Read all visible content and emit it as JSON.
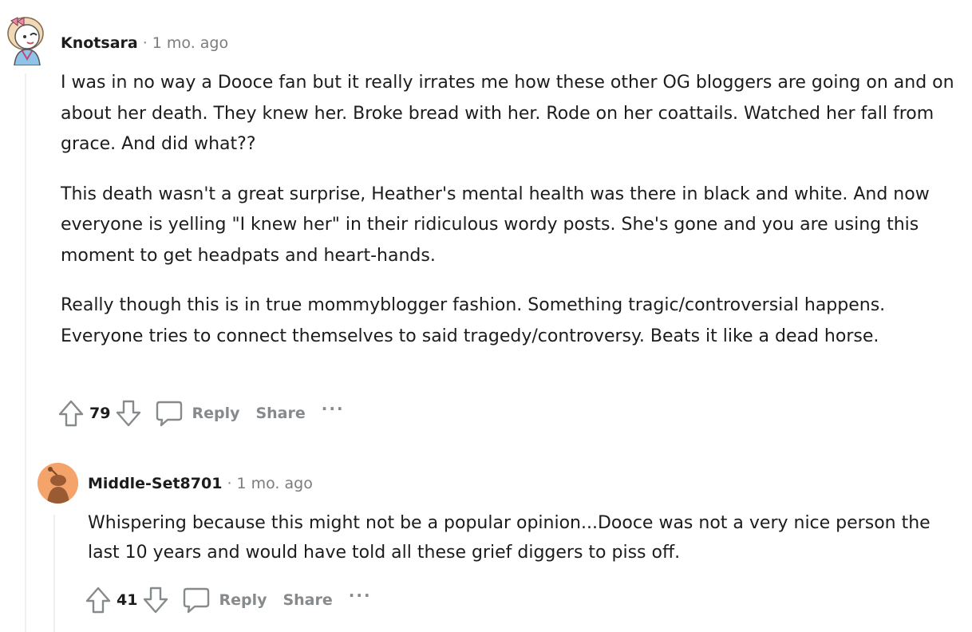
{
  "comments": [
    {
      "author": "Knotsara",
      "separator": "·",
      "time": "1 mo. ago",
      "paragraphs": [
        "I was in no way a Dooce fan but it really irrates me how these other OG bloggers are going on and on about her death. They knew her. Broke bread with her. Rode on her coattails. Watched her fall from grace. And did what??",
        "This death wasn't a great surprise, Heather's mental health was there in black and white. And now everyone is yelling \"I knew her\" in their ridiculous wordy posts. She's gone and you are using this moment to get headpats and heart-hands.",
        "Really though this is in true mommyblogger fashion. Something tragic/controversial happens. Everyone tries to connect themselves to said tragedy/controversy. Beats it like a dead horse."
      ],
      "score": "79",
      "reply_label": "Reply",
      "share_label": "Share",
      "more_label": "···"
    },
    {
      "author": "Middle-Set8701",
      "separator": "·",
      "time": "1 mo. ago",
      "paragraphs": [
        "Whispering because this might not be a popular opinion...Dooce was not a very nice person the last 10 years and would have told all these grief diggers to piss off."
      ],
      "score": "41",
      "reply_label": "Reply",
      "share_label": "Share",
      "more_label": "···"
    }
  ],
  "colors": {
    "thread_line": "#edeff1",
    "meta_gray": "#7c7c7c",
    "action_gray": "#878a8c",
    "avatar2_bg": "#f4a36b"
  },
  "icons": {
    "upvote": "arrow-up-icon",
    "downvote": "arrow-down-icon",
    "reply": "speech-bubble-icon",
    "more": "ellipsis-icon"
  }
}
